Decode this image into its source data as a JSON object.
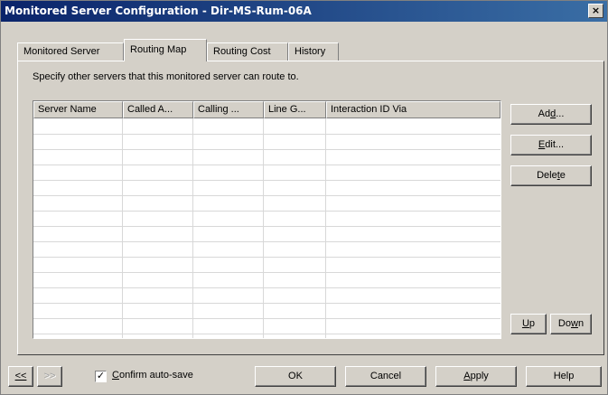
{
  "window": {
    "title": "Monitored Server Configuration - Dir-MS-Rum-06A",
    "close_label": "×"
  },
  "tabs": [
    {
      "label": "Monitored Server",
      "active": false
    },
    {
      "label": "Routing Map",
      "active": true
    },
    {
      "label": "Routing Cost",
      "active": false
    },
    {
      "label": "History",
      "active": false
    }
  ],
  "panel": {
    "description": "Specify other servers that this monitored server can route to.",
    "columns": [
      "Server Name",
      "Called A...",
      "Calling ...",
      "Line G...",
      "Interaction ID Via"
    ],
    "rows": []
  },
  "side_buttons": {
    "add": {
      "pre": "Ad",
      "accel": "d",
      "post": "..."
    },
    "edit": {
      "pre": "",
      "accel": "E",
      "post": "dit..."
    },
    "delete": {
      "pre": "Dele",
      "accel": "t",
      "post": "e"
    },
    "up": {
      "pre": "",
      "accel": "U",
      "post": "p"
    },
    "down": {
      "pre": "Do",
      "accel": "w",
      "post": "n"
    }
  },
  "footer": {
    "prev_label": "<<",
    "next_label": ">>",
    "confirm_autosave": {
      "pre": "",
      "accel": "C",
      "post": "onfirm auto-save",
      "checked": true,
      "check_glyph": "✓"
    },
    "ok_label": "OK",
    "cancel_label": "Cancel",
    "apply": {
      "pre": "",
      "accel": "A",
      "post": "pply"
    },
    "help_label": "Help"
  }
}
